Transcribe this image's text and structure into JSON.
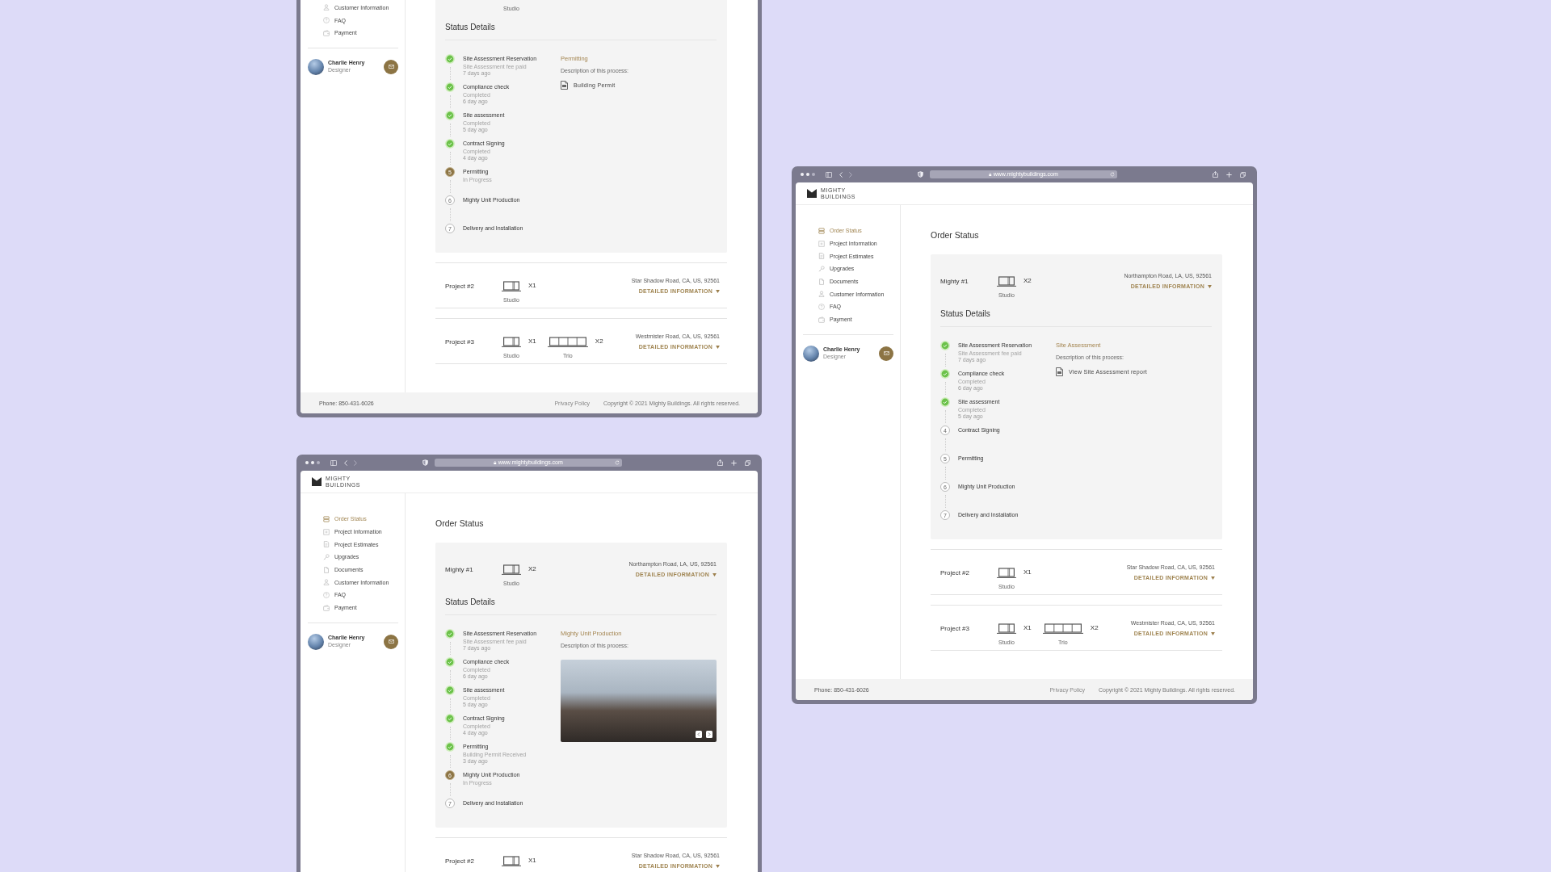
{
  "windows": [
    {
      "sidebar": {
        "items": [
          {
            "label": "Customer Information",
            "kind": "customer",
            "selected": false
          },
          {
            "label": "FAQ",
            "kind": "faq",
            "selected": false
          },
          {
            "label": "Payment",
            "kind": "payment",
            "selected": false
          }
        ],
        "user": {
          "name": "Charlie Henry",
          "role": "Designer"
        }
      },
      "main": {
        "projects": [
          {
            "units": [
              {
                "label": "Studio"
              }
            ],
            "status": {
              "title": "Status Details",
              "steps": [
                {
                  "title": "Site Assessment Reservation",
                  "kind": "done",
                  "note": "Site Assessment fee paid",
                  "time": "7 days ago"
                },
                {
                  "title": "Compliance check",
                  "kind": "done",
                  "note": "Completed",
                  "time": "6 day ago"
                },
                {
                  "title": "Site assessment",
                  "kind": "done",
                  "note": "Completed",
                  "time": "5 day ago"
                },
                {
                  "title": "Contract Signing",
                  "kind": "done",
                  "note": "Completed",
                  "time": "4 day ago"
                },
                {
                  "title": "Permitting",
                  "kind": "current",
                  "number": "5",
                  "note": "In Progress"
                },
                {
                  "title": "Mighty Unit Production",
                  "kind": "pending",
                  "number": "6"
                },
                {
                  "title": "Delivery and Installation",
                  "kind": "pending",
                  "number": "7"
                }
              ],
              "panel": {
                "kind": "file",
                "title": "Permitting",
                "description": "Description of this process:",
                "file": "Building Permit"
              }
            }
          },
          {
            "name": "Project #2",
            "units": [
              {
                "kind": "studio",
                "label": "Studio",
                "count": "X1"
              }
            ],
            "address": "Star Shadow Road, CA, US, 92561",
            "link": "DETAILED INFORMATION"
          },
          {
            "name": "Project #3",
            "units": [
              {
                "kind": "studio",
                "label": "Studio",
                "count": "X1"
              },
              {
                "kind": "trio",
                "label": "Trio",
                "count": "X2"
              }
            ],
            "address": "Westmister Road, CA, US, 92561",
            "link": "DETAILED INFORMATION"
          }
        ]
      },
      "footer": {
        "phone": "Phone: 850-431-6026",
        "links": [
          "Privacy Policy"
        ],
        "copyright": "Copyright © 2021 Mighty Buildings. All rights reserved."
      }
    },
    {
      "toolbar": {
        "url": "www.mightybuildings.com"
      },
      "header": {
        "logo_lines": [
          "MIGHTY",
          "BUILDINGS"
        ]
      },
      "sidebar": {
        "items": [
          {
            "label": "Order Status",
            "kind": "status",
            "selected": true
          },
          {
            "label": "Project Information",
            "kind": "info",
            "selected": false
          },
          {
            "label": "Project Estimates",
            "kind": "estimate",
            "selected": false
          },
          {
            "label": "Upgrades",
            "kind": "upgrade",
            "selected": false
          },
          {
            "label": "Documents",
            "kind": "document",
            "selected": false
          },
          {
            "label": "Customer Information",
            "kind": "customer",
            "selected": false
          },
          {
            "label": "FAQ",
            "kind": "faq",
            "selected": false
          },
          {
            "label": "Payment",
            "kind": "payment",
            "selected": false
          }
        ],
        "user": {
          "name": "Charlie Henry",
          "role": "Designer"
        }
      },
      "main": {
        "title": "Order Status",
        "projects": [
          {
            "name": "Mighty #1",
            "units": [
              {
                "kind": "studio",
                "label": "Studio",
                "count": "X2"
              }
            ],
            "address": "Northampton Road, LA, US, 92561",
            "link": "DETAILED INFORMATION",
            "status": {
              "title": "Status Details",
              "steps": [
                {
                  "title": "Site Assessment Reservation",
                  "kind": "done",
                  "note": "Site Assessment fee paid",
                  "time": "7 days ago"
                },
                {
                  "title": "Compliance check",
                  "kind": "done",
                  "note": "Completed",
                  "time": "6 day ago"
                },
                {
                  "title": "Site assessment",
                  "kind": "done",
                  "note": "Completed",
                  "time": "5 day ago"
                },
                {
                  "title": "Contract Signing",
                  "kind": "pending",
                  "number": "4"
                },
                {
                  "title": "Permitting",
                  "kind": "pending",
                  "number": "5"
                },
                {
                  "title": "Mighty Unit Production",
                  "kind": "pending",
                  "number": "6"
                },
                {
                  "title": "Delivery and Installation",
                  "kind": "pending",
                  "number": "7"
                }
              ],
              "panel": {
                "kind": "file",
                "title": "Site Assessment",
                "description": "Description of this process:",
                "file": "View Site Assessment report"
              }
            }
          },
          {
            "name": "Project #2",
            "units": [
              {
                "kind": "studio",
                "label": "Studio",
                "count": "X1"
              }
            ],
            "address": "Star Shadow Road, CA, US, 92561",
            "link": "DETAILED INFORMATION"
          },
          {
            "name": "Project #3",
            "units": [
              {
                "kind": "studio",
                "label": "Studio",
                "count": "X1"
              },
              {
                "kind": "trio",
                "label": "Trio",
                "count": "X2"
              }
            ],
            "address": "Westmister Road, CA, US, 92561",
            "link": "DETAILED INFORMATION"
          }
        ]
      },
      "footer": {
        "phone": "Phone: 850-431-6026",
        "links": [
          "Privacy Policy"
        ],
        "copyright": "Copyright © 2021 Mighty Buildings. All rights reserved."
      }
    },
    {
      "toolbar": {
        "url": "www.mightybuildings.com"
      },
      "header": {
        "logo_lines": [
          "MIGHTY",
          "BUILDINGS"
        ]
      },
      "sidebar": {
        "items": [
          {
            "label": "Order Status",
            "kind": "status",
            "selected": true
          },
          {
            "label": "Project Information",
            "kind": "info",
            "selected": false
          },
          {
            "label": "Project Estimates",
            "kind": "estimate",
            "selected": false
          },
          {
            "label": "Upgrades",
            "kind": "upgrade",
            "selected": false
          },
          {
            "label": "Documents",
            "kind": "document",
            "selected": false
          },
          {
            "label": "Customer Information",
            "kind": "customer",
            "selected": false
          },
          {
            "label": "FAQ",
            "kind": "faq",
            "selected": false
          },
          {
            "label": "Payment",
            "kind": "payment",
            "selected": false
          }
        ],
        "user": {
          "name": "Charlie Henry",
          "role": "Designer"
        }
      },
      "main": {
        "title": "Order Status",
        "projects": [
          {
            "name": "Mighty #1",
            "units": [
              {
                "kind": "studio",
                "label": "Studio",
                "count": "X2"
              }
            ],
            "address": "Northampton Road, LA, US, 92561",
            "link": "DETAILED INFORMATION",
            "status": {
              "title": "Status Details",
              "steps": [
                {
                  "title": "Site Assessment Reservation",
                  "kind": "done",
                  "note": "Site Assessment fee paid",
                  "time": "7 days ago"
                },
                {
                  "title": "Compliance check",
                  "kind": "done",
                  "note": "Completed",
                  "time": "6 day ago"
                },
                {
                  "title": "Site assessment",
                  "kind": "done",
                  "note": "Completed",
                  "time": "5 day ago"
                },
                {
                  "title": "Contract Signing",
                  "kind": "done",
                  "note": "Completed",
                  "time": "4 day ago"
                },
                {
                  "title": "Permitting",
                  "kind": "done",
                  "note": "Building Permit Received",
                  "time": "3 day ago"
                },
                {
                  "title": "Mighty Unit Production",
                  "kind": "current",
                  "number": "6",
                  "note": "In Progress"
                },
                {
                  "title": "Delivery and Installation",
                  "kind": "pending",
                  "number": "7"
                }
              ],
              "panel": {
                "kind": "image",
                "title": "Mighty Unit Production",
                "description": "Description of this process:"
              }
            }
          },
          {
            "name": "Project #2",
            "units": [
              {
                "kind": "studio",
                "count": "X1"
              }
            ],
            "address": "Star Shadow Road, CA, US, 92561",
            "link": "DETAILED INFORMATION"
          }
        ]
      }
    }
  ]
}
